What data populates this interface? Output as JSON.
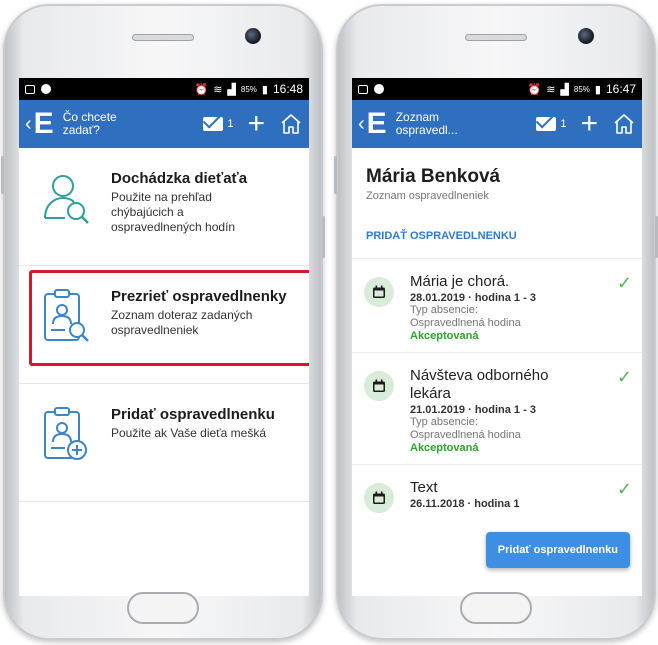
{
  "left": {
    "status": {
      "battery": "85%",
      "time": "16:48"
    },
    "appbar": {
      "title": "Čo chcete zadať?",
      "mail_count": "1"
    },
    "menu": [
      {
        "title": "Dochádzka dieťaťa",
        "subtitle": "Použite na prehľad chýbajúcich a ospravedlnených hodín"
      },
      {
        "title": "Prezrieť ospravedlnenky",
        "subtitle": "Zoznam doteraz zadaných ospravedlneniek"
      },
      {
        "title": "Pridať ospravedlnenku",
        "subtitle": "Použite ak Vaše dieťa mešká"
      }
    ]
  },
  "right": {
    "status": {
      "battery": "85%",
      "time": "16:47"
    },
    "appbar": {
      "title": "Zoznam ospravedl...",
      "mail_count": "1"
    },
    "profile": {
      "name": "Mária Benková",
      "subtitle": "Zoznam ospravedlneniek"
    },
    "add_link": "PRIDAŤ OSPRAVEDLNENKU",
    "excuses": [
      {
        "title": "Mária je chorá.",
        "date": "28.01.2019 · hodina 1 - 3",
        "type_label": "Typ absencie:",
        "type_value": "Ospravedlnená hodina",
        "status": "Akceptovaná"
      },
      {
        "title": "Návšteva odborného lekára",
        "date": "21.01.2019 · hodina 1 - 3",
        "type_label": "Typ absencie:",
        "type_value": "Ospravedlnená hodina",
        "status": "Akceptovaná"
      },
      {
        "title": "Text",
        "date": "26.11.2018 · hodina 1",
        "type_label": "",
        "type_value": "",
        "status": ""
      }
    ],
    "fab_label": "Pridať ospravedlnenku"
  },
  "colors": {
    "appbar": "#2f6fbf",
    "accent": "#2f7ad0",
    "accepted": "#2ea32e",
    "highlight": "#d3192b"
  }
}
